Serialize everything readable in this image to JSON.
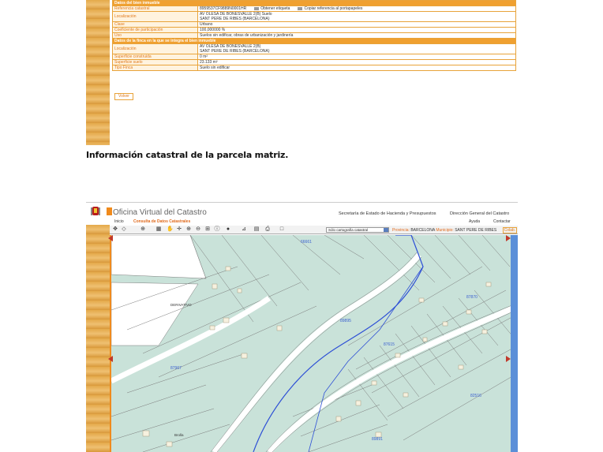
{
  "table": {
    "rows": [
      {
        "type": "section",
        "label": "Datos del bien inmueble",
        "value": ""
      },
      {
        "type": "row",
        "label": "Referencia catastral",
        "value": "8959537CF9889N0001HR",
        "action1": "Obtener etiqueta",
        "action2": "Copiar referencia al portapapeles"
      },
      {
        "type": "row",
        "label": "Localización",
        "value": "AV OLESA DE BONESVALLE 2(B) Suelo",
        "value2": "SANT PERE DE RIBES (BARCELONA)"
      },
      {
        "type": "row",
        "label": "Clase",
        "value": "Urbano"
      },
      {
        "type": "row",
        "label": "Coeficiente de participación",
        "value": "100,000000 %"
      },
      {
        "type": "row",
        "label": "Uso",
        "value": "Suelos sin edificar, obras de urbanización y jardinería"
      },
      {
        "type": "section",
        "label": "Datos de la finca en la que se integra el bien inmueble",
        "value": ""
      },
      {
        "type": "row",
        "label": "Localización",
        "value": "AV OLESA DE BONESVALLE 2(B)",
        "value2": "SANT PERE DE RIBES (BARCELONA)"
      },
      {
        "type": "row",
        "label": "Superficie construida",
        "value": "0 m²"
      },
      {
        "type": "row",
        "label": "Superficie suelo",
        "value": "23.133 m²"
      },
      {
        "type": "row",
        "label": "Tipo Finca",
        "value": "Suelo sin edificar"
      }
    ],
    "back_label": "Volver"
  },
  "caption": "Información catastral de la parcela matriz.",
  "viewer": {
    "title": "Oficina Virtual del Catastro",
    "link1": "Secretaría de Estado de Hacienda y Presupuestos",
    "link2": "Dirección General del Catastro",
    "menu_home": "Inicio",
    "menu_consult": "Consulta de Datos Catastrales",
    "menu_help": "Ayuda",
    "menu_contact": "Contactar",
    "layer": "Sólo cartografía catastral",
    "province_label": "Provincia:",
    "province": "BARCELONA",
    "municipality_label": "Municipio:",
    "municipality": "SANT PERE DE RIBES",
    "badge": "Colab.",
    "map_labels": {
      "zone1": "66661",
      "zone2": "89895",
      "zone3": "87870",
      "zone4": "82516",
      "zone5": "87967",
      "zone6": "89891",
      "zone7": "87615",
      "place1": "DERIVATIVO",
      "place2": "Brolla"
    }
  },
  "colors": {
    "orange": "#f0a030",
    "map_fill": "#c9e2d9",
    "parcel_line": "#7a7a7a",
    "highlight": "#2d4fd6"
  }
}
